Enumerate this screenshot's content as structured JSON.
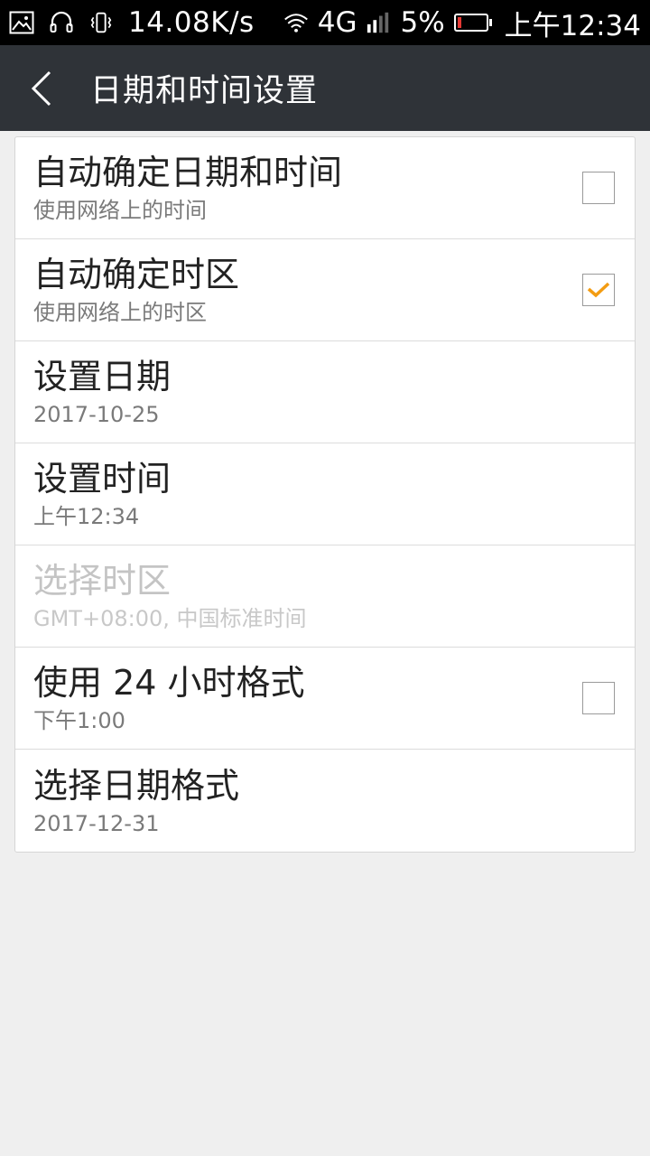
{
  "status_bar": {
    "speed": "14.08K/s",
    "network": "4G",
    "battery_percent": "5%",
    "time": "上午12:34",
    "battery_level": 0.12,
    "battery_color": "#e53935"
  },
  "header": {
    "title": "日期和时间设置"
  },
  "settings": [
    {
      "label": "自动确定日期和时间",
      "summary": "使用网络上的时间",
      "checked": false
    },
    {
      "label": "自动确定时区",
      "summary": "使用网络上的时区",
      "checked": true
    },
    {
      "label": "设置日期",
      "summary": "2017-10-25"
    },
    {
      "label": "设置时间",
      "summary": "上午12:34"
    },
    {
      "label": "选择时区",
      "summary": "GMT+08:00, 中国标准时间",
      "disabled": true
    },
    {
      "label": "使用 24 小时格式",
      "summary": "下午1:00",
      "checked": false
    },
    {
      "label": "选择日期格式",
      "summary": "2017-12-31"
    }
  ],
  "colors": {
    "accent_check": "#f39c12",
    "header_bg": "#2f3338"
  }
}
